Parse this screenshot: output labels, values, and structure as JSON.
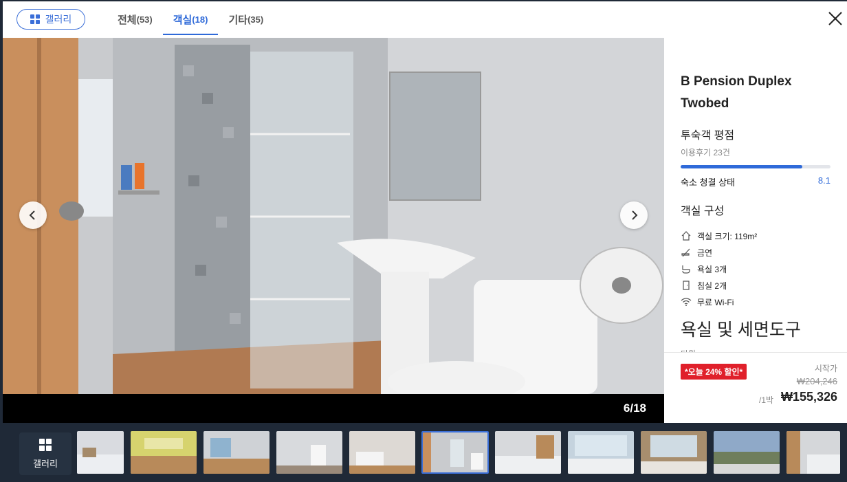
{
  "header": {
    "gallery_label": "갤러리",
    "tabs": [
      {
        "label": "전체",
        "count": "(53)"
      },
      {
        "label": "객실",
        "count": "(18)"
      },
      {
        "label": "기타",
        "count": "(35)"
      }
    ],
    "active_tab": "객실"
  },
  "viewer": {
    "counter": "6/18"
  },
  "room": {
    "title": "B Pension Duplex Twobed",
    "rating_title": "투숙객 평점",
    "review_count": "이용후기 23건",
    "clean_label": "숙소 청결 상태",
    "clean_score": "8.1",
    "clean_fraction": 0.81,
    "config_title": "객실 구성",
    "features": [
      {
        "icon": "house-icon",
        "label": "객실 크기: 119m²"
      },
      {
        "icon": "no-smoking-icon",
        "label": "금연"
      },
      {
        "icon": "bath-icon",
        "label": "욕실 3개"
      },
      {
        "icon": "door-icon",
        "label": "침실 2개"
      },
      {
        "icon": "wifi-icon",
        "label": "무료 Wi-Fi"
      }
    ],
    "amenity_title": "욕실 및 세면도구",
    "amenity_cut": "타월"
  },
  "price": {
    "discount_badge": "*오늘 24% 할인*",
    "start_label": "시작가",
    "original": "₩204,246",
    "per_night": "/1박",
    "final": "₩155,326"
  },
  "strip": {
    "gallery_label": "갤러리",
    "active_index": 5
  },
  "colors": {
    "accent": "#2f6ad9",
    "discount": "#e0202b",
    "strip_bg": "#1f2937"
  }
}
